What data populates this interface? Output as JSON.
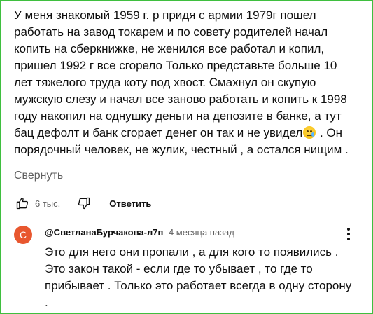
{
  "comment": {
    "text_before_emoji": "У меня знакомый 1959 г. р придя с армии 1979г пошел\nработать на завод токарем и по совету родителей начал\nкопить на сберкнижке, не женился все работал и копил,\nпришел 1992 г все сгорело  Только представьте больше 10\nлет тяжелого труда коту под хвост. Смахнул он скупую\nмужскую слезу и начал все заново работать и копить к 1998\nгоду накопил на однушку деньги на депозите в банке, а тут\nбац дефолт и банк сгорает денег он так и не увидел",
    "text_after_emoji": " . Он\nпорядочный человек, не жулик, честный , а остался нищим .",
    "emoji": "crying-face-icon",
    "collapse_label": "Свернуть",
    "like_count": "6 тыс.",
    "reply_label": "Ответить"
  },
  "reply": {
    "avatar_letter": "С",
    "avatar_color": "#e8572f",
    "author": "@СветланаБурчакова-л7п",
    "time": "4 месяца назад",
    "text": "Это для него они пропали , а для кого то появились .\nЭто закон такой - если где то убывает , то где то\nприбывает . Только это работает всегда в одну сторону\n."
  },
  "colors": {
    "border": "#3fbf3f",
    "secondary_text": "#606060"
  }
}
